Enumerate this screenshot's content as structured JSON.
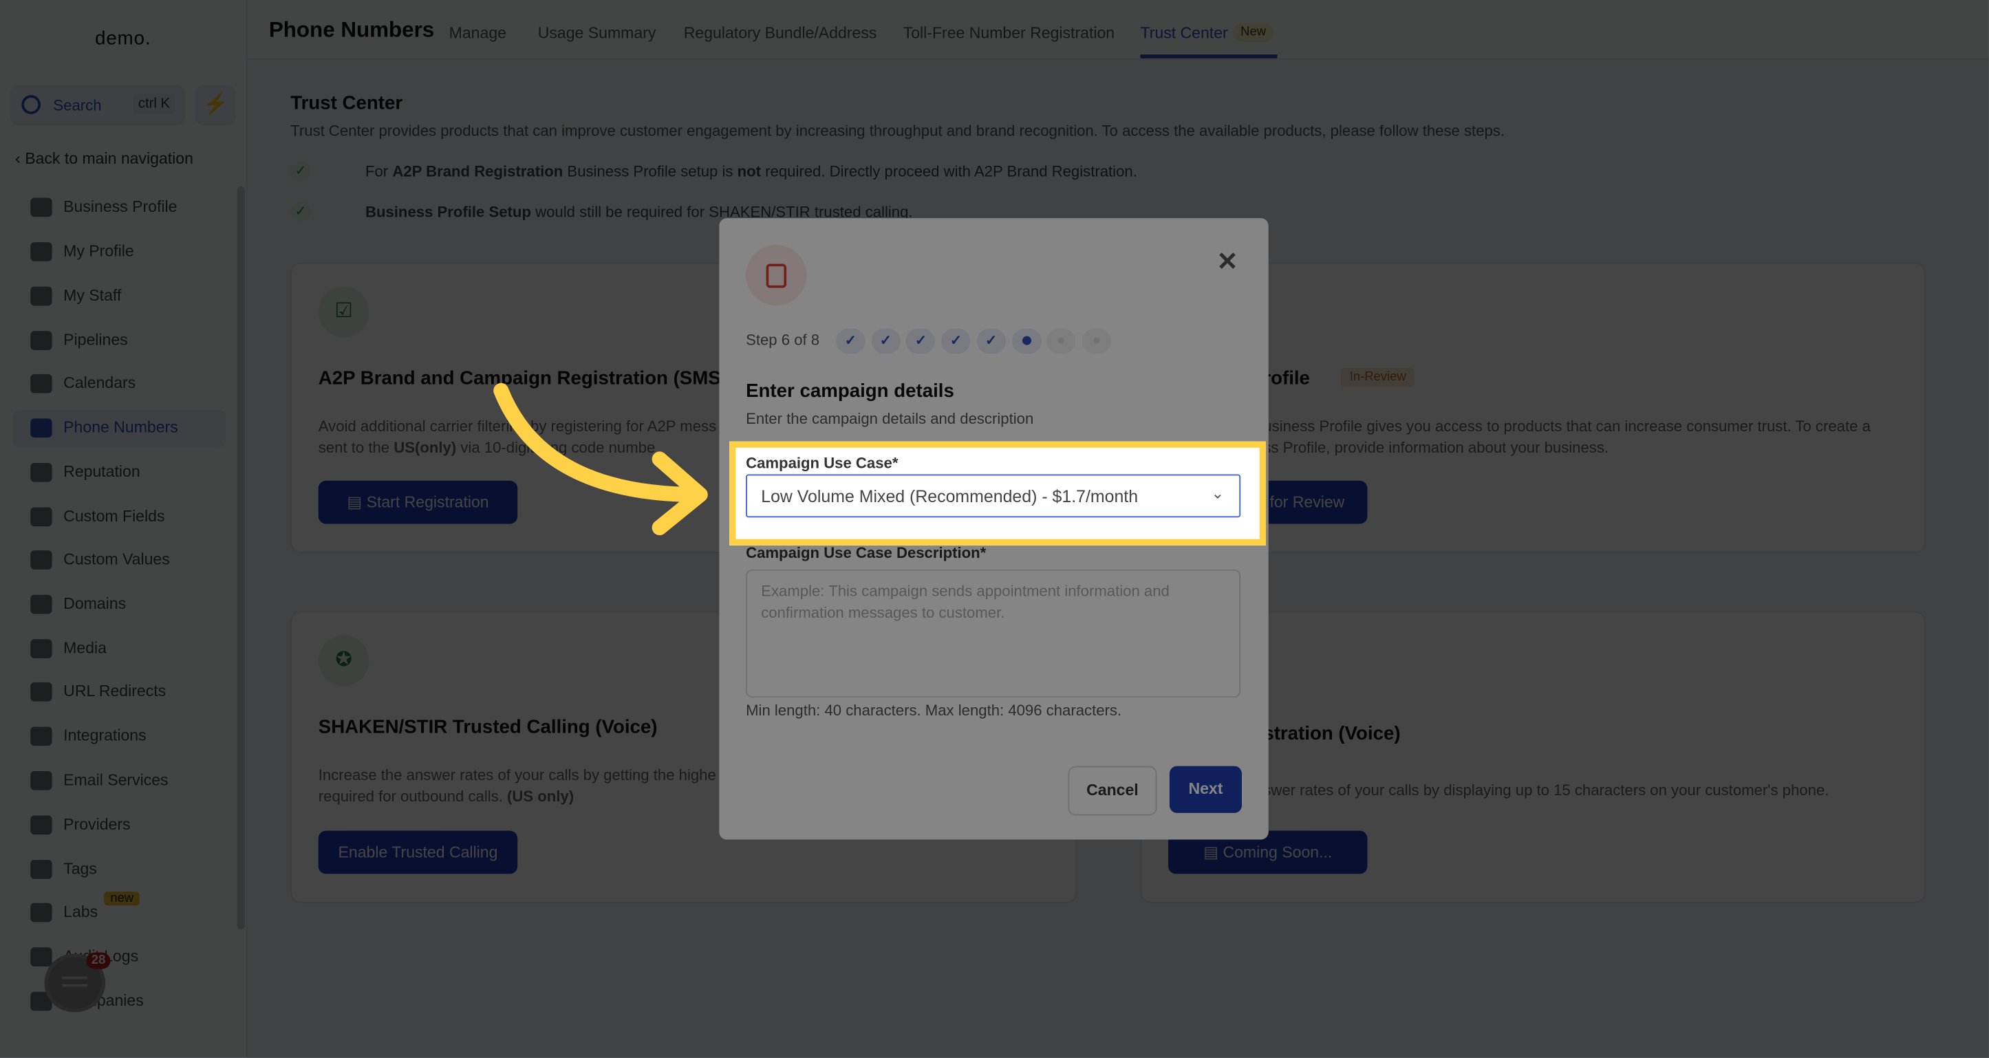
{
  "sidebar": {
    "logo": "demo.",
    "search_label": "Search",
    "search_shortcut": "ctrl K",
    "back_label": "Back to main navigation",
    "items": [
      {
        "label": "Business Profile"
      },
      {
        "label": "My Profile"
      },
      {
        "label": "My Staff"
      },
      {
        "label": "Pipelines"
      },
      {
        "label": "Calendars"
      },
      {
        "label": "Phone Numbers",
        "active": true
      },
      {
        "label": "Reputation"
      },
      {
        "label": "Custom Fields"
      },
      {
        "label": "Custom Values"
      },
      {
        "label": "Domains"
      },
      {
        "label": "Media"
      },
      {
        "label": "URL Redirects"
      },
      {
        "label": "Integrations"
      },
      {
        "label": "Email Services"
      },
      {
        "label": "Providers"
      },
      {
        "label": "Tags"
      },
      {
        "label": "Labs",
        "badge": "new"
      },
      {
        "label": "Audit Logs"
      },
      {
        "label": "Companies"
      }
    ]
  },
  "header": {
    "title": "Phone Numbers",
    "tabs": [
      {
        "label": "Manage"
      },
      {
        "label": "Usage Summary"
      },
      {
        "label": "Regulatory Bundle/Address"
      },
      {
        "label": "Toll-Free Number Registration"
      },
      {
        "label": "Trust Center",
        "active": true,
        "badge": "New"
      }
    ]
  },
  "main": {
    "title": "Trust Center",
    "description": "Trust Center provides products that can improve customer engagement by increasing throughput and brand recognition. To access the available products, please follow these steps.",
    "steps": [
      {
        "pre": "For ",
        "b1": "A2P Brand Registration",
        "mid": " Business Profile setup is ",
        "b2": "not",
        "post": " required. Directly proceed with A2P Brand Registration."
      },
      {
        "b1": "Business Profile Setup",
        "post": " would still be required for SHAKEN/STIR trusted calling."
      }
    ],
    "cards": [
      {
        "title": "A2P Brand and Campaign Registration (SMS)",
        "desc1": "Avoid additional carrier filtering by registering for A2P mess",
        "desc2_pre": "sent to the ",
        "desc2_b": "US(only)",
        "desc2_post": " via 10-digit long code numbe",
        "button": "Start Registration"
      },
      {
        "title": "rofile",
        "status": "In-Review",
        "desc1": "usiness Profile gives you access to products that can increase consumer trust. To create a",
        "desc2": "ss Profile, provide information about your business.",
        "button": "for Review"
      },
      {
        "title": "SHAKEN/STIR Trusted Calling (Voice)",
        "desc1": "Increase the answer rates of your calls by getting the highe",
        "desc2_pre": "required for outbound calls. ",
        "desc2_b": "(US only)",
        "button": "Enable Trusted Calling"
      },
      {
        "title": "stration (Voice)",
        "desc1": "swer rates of your calls by displaying up to 15 characters on your customer's phone.",
        "button": "Coming Soon..."
      }
    ]
  },
  "modal": {
    "step_text": "Step 6 of 8",
    "steps_total": 8,
    "current_step": 6,
    "heading": "Enter campaign details",
    "subheading": "Enter the campaign details and description",
    "use_case_label": "Campaign Use Case*",
    "use_case_value": "Low Volume Mixed (Recommended) - $1.7/month",
    "description_label": "Campaign Use Case Description*",
    "description_placeholder": "Example: This campaign sends appointment information and confirmation messages to customer.",
    "hint": "Min length: 40 characters. Max length: 4096 characters.",
    "cancel": "Cancel",
    "next": "Next"
  },
  "chat": {
    "count": "28"
  },
  "colors": {
    "primary": "#1d3fb0",
    "highlight": "#ffd146",
    "status_in_review": "#c2671b"
  }
}
